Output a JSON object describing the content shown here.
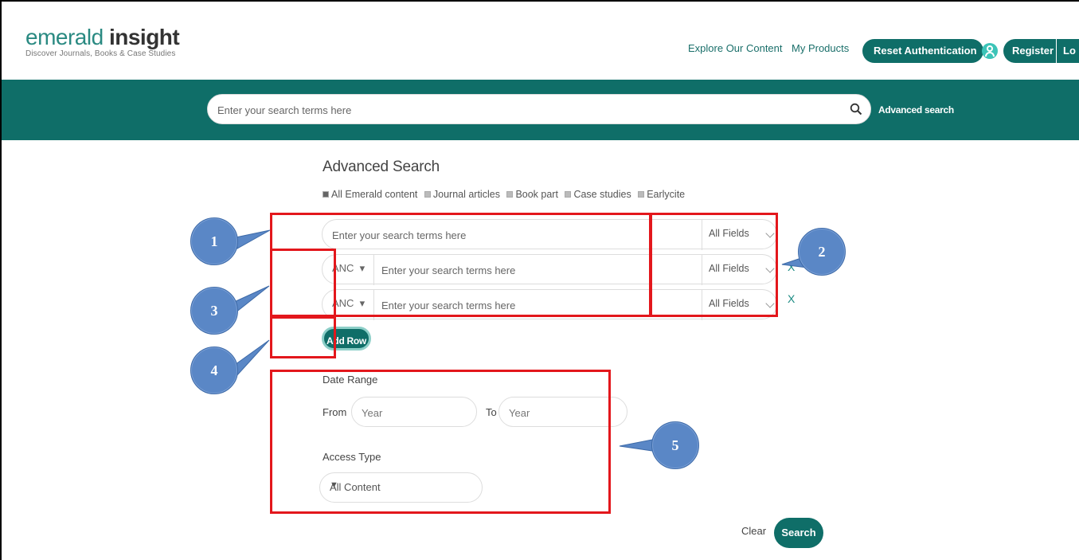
{
  "header": {
    "logo_light": "emerald",
    "logo_bold": "insight",
    "tagline": "Discover Journals, Books & Case Studies",
    "nav": {
      "explore": "Explore Our Content",
      "my_products": "My Products",
      "reset_auth": "Reset Authentication",
      "register": "Register",
      "login_partial": "Lo"
    }
  },
  "top_search": {
    "placeholder": "Enter your search terms here",
    "advanced_link": "Advanced search"
  },
  "advanced": {
    "title": "Advanced Search",
    "content_types": [
      {
        "label": "All Emerald content",
        "checked": true
      },
      {
        "label": "Journal articles",
        "checked": false
      },
      {
        "label": "Book part",
        "checked": false
      },
      {
        "label": "Case studies",
        "checked": false
      },
      {
        "label": "Earlycite",
        "checked": false
      }
    ],
    "rows": [
      {
        "placeholder": "Enter your search terms here",
        "field": "All Fields"
      },
      {
        "operator": "ANC",
        "placeholder": "Enter your search terms here",
        "field": "All Fields",
        "remove": "X"
      },
      {
        "operator": "ANC",
        "placeholder": "Enter your search terms here",
        "field": "All Fields",
        "remove": "X"
      }
    ],
    "add_row": "Add Row",
    "date_range": {
      "label": "Date Range",
      "from_label": "From",
      "to_label": "To",
      "from_placeholder": "Year",
      "to_placeholder": "Year"
    },
    "access_type": {
      "label": "Access Type",
      "selected": "All Content"
    },
    "clear": "Clear",
    "search": "Search"
  },
  "annotations": {
    "callouts": [
      "1",
      "2",
      "3",
      "4",
      "5"
    ],
    "colors": {
      "box": "#e3171c",
      "callout": "#5a87c6"
    }
  },
  "colors": {
    "brand": "#0f6e68",
    "link": "#1a6f6a"
  }
}
